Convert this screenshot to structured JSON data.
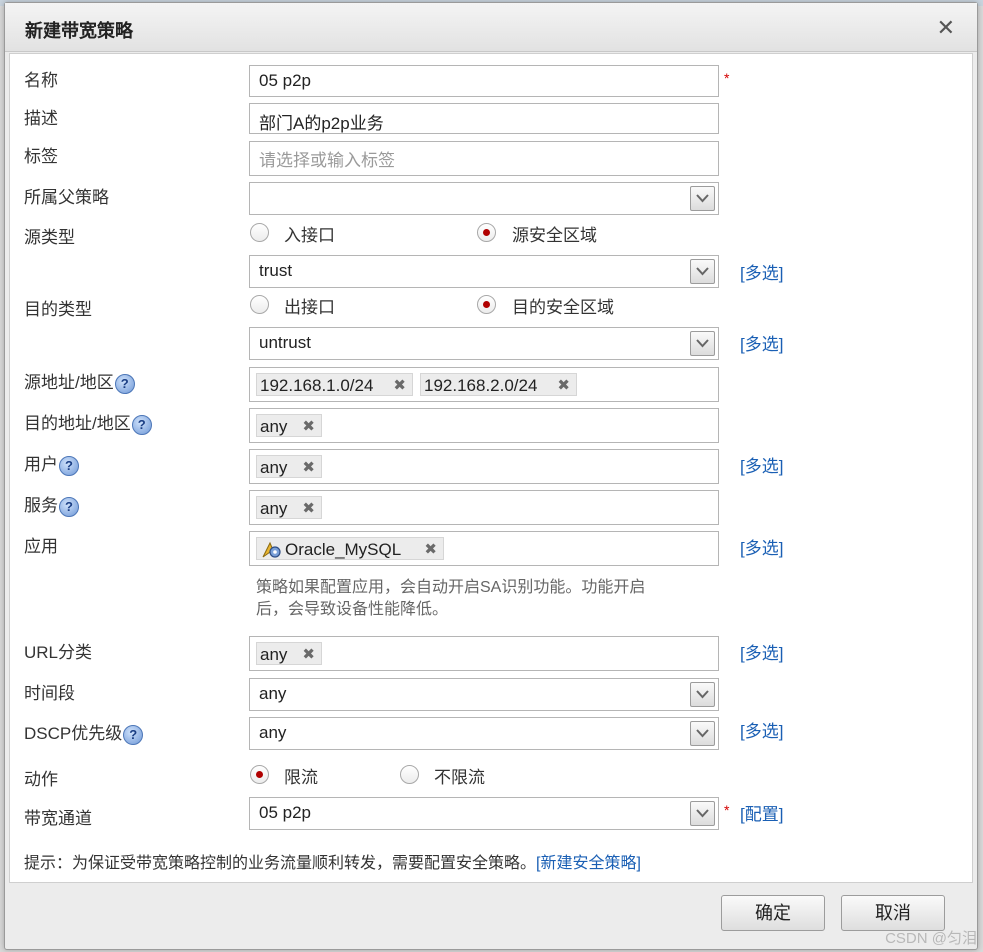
{
  "dialog": {
    "title": "新建带宽策略",
    "close_symbol": "✕"
  },
  "form": {
    "name": {
      "label": "名称",
      "value": "05 p2p",
      "required": "*"
    },
    "description": {
      "label": "描述",
      "value": "部门A的p2p业务"
    },
    "tag": {
      "label": "标签",
      "placeholder": "请选择或输入标签"
    },
    "parent_policy": {
      "label": "所属父策略",
      "value": ""
    },
    "source_type": {
      "label": "源类型",
      "option1": "入接口",
      "option2": "源安全区域",
      "selected": "源安全区域",
      "zone": "trust",
      "multi_link": "[多选]"
    },
    "dest_type": {
      "label": "目的类型",
      "option1": "出接口",
      "option2": "目的安全区域",
      "selected": "目的安全区域",
      "zone": "untrust",
      "multi_link": "[多选]"
    },
    "source_address": {
      "label": "源地址/地区",
      "tags": [
        "192.168.1.0/24",
        "192.168.2.0/24"
      ]
    },
    "dest_address": {
      "label": "目的地址/地区",
      "tags": [
        "any"
      ]
    },
    "user": {
      "label": "用户",
      "tags": [
        "any"
      ],
      "multi_link": "[多选]"
    },
    "service": {
      "label": "服务",
      "tags": [
        "any"
      ]
    },
    "application": {
      "label": "应用",
      "tags": [
        "Oracle_MySQL"
      ],
      "multi_link": "[多选]",
      "hint_line1": "策略如果配置应用，会自动开启SA识别功能。功能开启",
      "hint_line2": "后，会导致设备性能降低。"
    },
    "url_category": {
      "label": "URL分类",
      "tags": [
        "any"
      ],
      "multi_link": "[多选]"
    },
    "time_range": {
      "label": "时间段",
      "value": "any"
    },
    "dscp": {
      "label": "DSCP优先级",
      "value": "any",
      "multi_link": "[多选]"
    },
    "action": {
      "label": "动作",
      "option1": "限流",
      "option2": "不限流",
      "selected": "限流"
    },
    "bandwidth_channel": {
      "label": "带宽通道",
      "value": "05 p2p",
      "required": "*",
      "config_link": "[配置]"
    },
    "help_icon": "?",
    "tag_remove": "✖"
  },
  "tip": {
    "text": "提示：为保证受带宽策略控制的业务流量顺利转发，需要配置安全策略。",
    "link": "[新建安全策略]"
  },
  "buttons": {
    "ok": "确定",
    "cancel": "取消"
  },
  "watermark": "CSDN @匀泪",
  "colors": {
    "link": "#1a5fb4",
    "required": "#d40000",
    "radio_selected": "#b00000"
  }
}
